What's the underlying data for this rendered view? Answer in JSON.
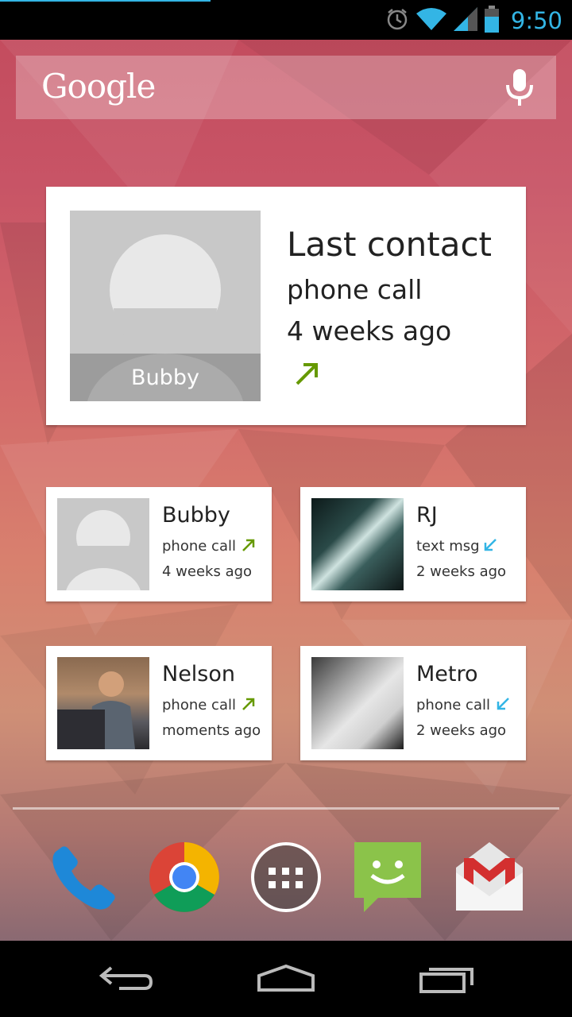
{
  "status_bar": {
    "time": "9:50",
    "icons": [
      "alarm-icon",
      "wifi-icon",
      "signal-icon",
      "battery-icon"
    ],
    "accent_color": "#33b5e5"
  },
  "search": {
    "logo_text": "Google",
    "icons": [
      "mic-icon"
    ]
  },
  "last_contact_card": {
    "title": "Last contact",
    "contact_name": "Bubby",
    "type": "phone call",
    "time": "4 weeks ago",
    "direction": "outgoing",
    "direction_color": "#669900"
  },
  "contacts": [
    {
      "name": "Bubby",
      "type": "phone call",
      "time": "4 weeks ago",
      "direction": "outgoing",
      "photo": "default-avatar"
    },
    {
      "name": "RJ",
      "type": "text msg",
      "time": "2 weeks ago",
      "direction": "incoming",
      "photo": "photo"
    },
    {
      "name": "Nelson",
      "type": "phone call",
      "time": "moments ago",
      "direction": "outgoing",
      "photo": "photo"
    },
    {
      "name": "Metro",
      "type": "phone call",
      "time": "2 weeks ago",
      "direction": "incoming",
      "photo": "photo"
    }
  ],
  "colors": {
    "outgoing_arrow": "#669900",
    "incoming_arrow": "#33b5e5"
  },
  "dock": [
    "phone-icon",
    "chrome-icon",
    "app-drawer-icon",
    "messaging-icon",
    "gmail-icon"
  ],
  "nav": [
    "back-icon",
    "home-icon",
    "recent-apps-icon"
  ]
}
